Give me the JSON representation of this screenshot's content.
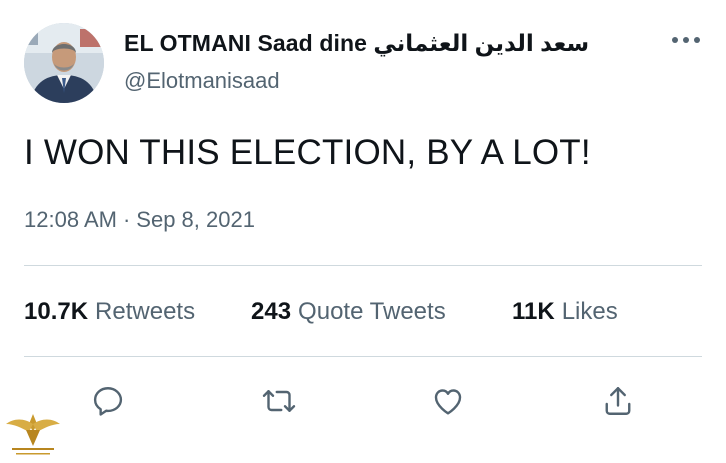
{
  "user": {
    "display_name": "سعد الدين العثماني EL OTMANI Saad dine",
    "handle": "@Elotmanisaad",
    "avatar_icon": "profile-photo"
  },
  "tweet": {
    "text": "I WON THIS ELECTION, BY A LOT!",
    "time": "12:08 AM",
    "separator": "·",
    "date": "Sep 8, 2021"
  },
  "stats": {
    "retweets_count": "10.7K",
    "retweets_label": "Retweets",
    "quotes_count": "243",
    "quotes_label": "Quote Tweets",
    "likes_count": "11K",
    "likes_label": "Likes"
  },
  "actions": [
    "reply-icon",
    "retweet-icon",
    "like-icon",
    "share-icon"
  ],
  "colors": {
    "text_primary": "#0f1419",
    "text_secondary": "#536471",
    "divider": "#cfd9de",
    "icon": "#536471"
  }
}
